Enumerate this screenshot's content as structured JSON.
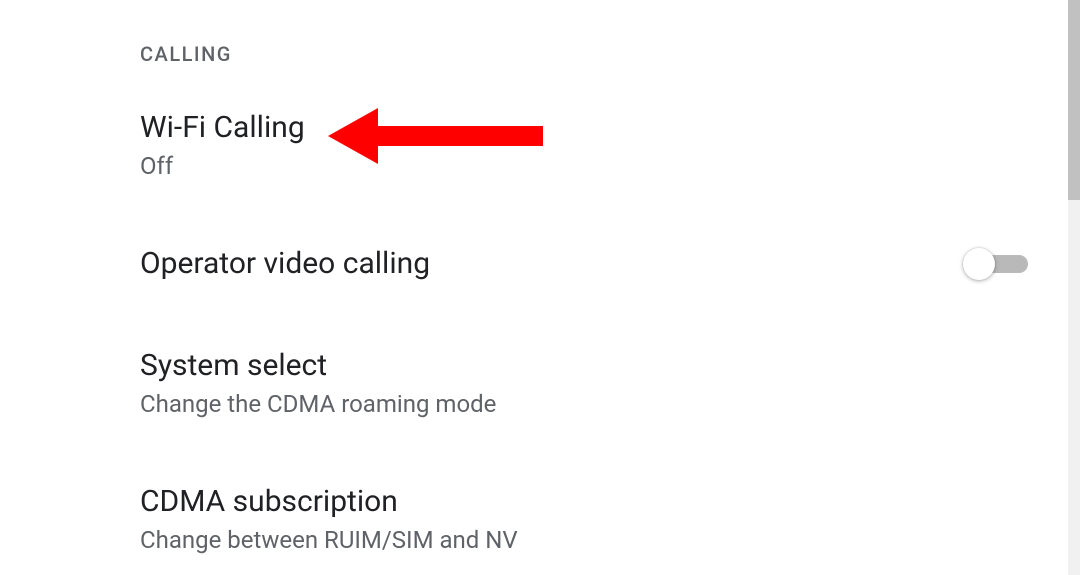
{
  "section": {
    "header": "CALLING"
  },
  "settings": {
    "wifi_calling": {
      "title": "Wi-Fi Calling",
      "subtitle": "Off"
    },
    "operator_video": {
      "title": "Operator video calling",
      "toggle_state": "off"
    },
    "system_select": {
      "title": "System select",
      "subtitle": "Change the CDMA roaming mode"
    },
    "cdma_subscription": {
      "title": "CDMA subscription",
      "subtitle": "Change between RUIM/SIM and NV"
    }
  },
  "annotation": {
    "arrow_color": "#ff0000"
  }
}
